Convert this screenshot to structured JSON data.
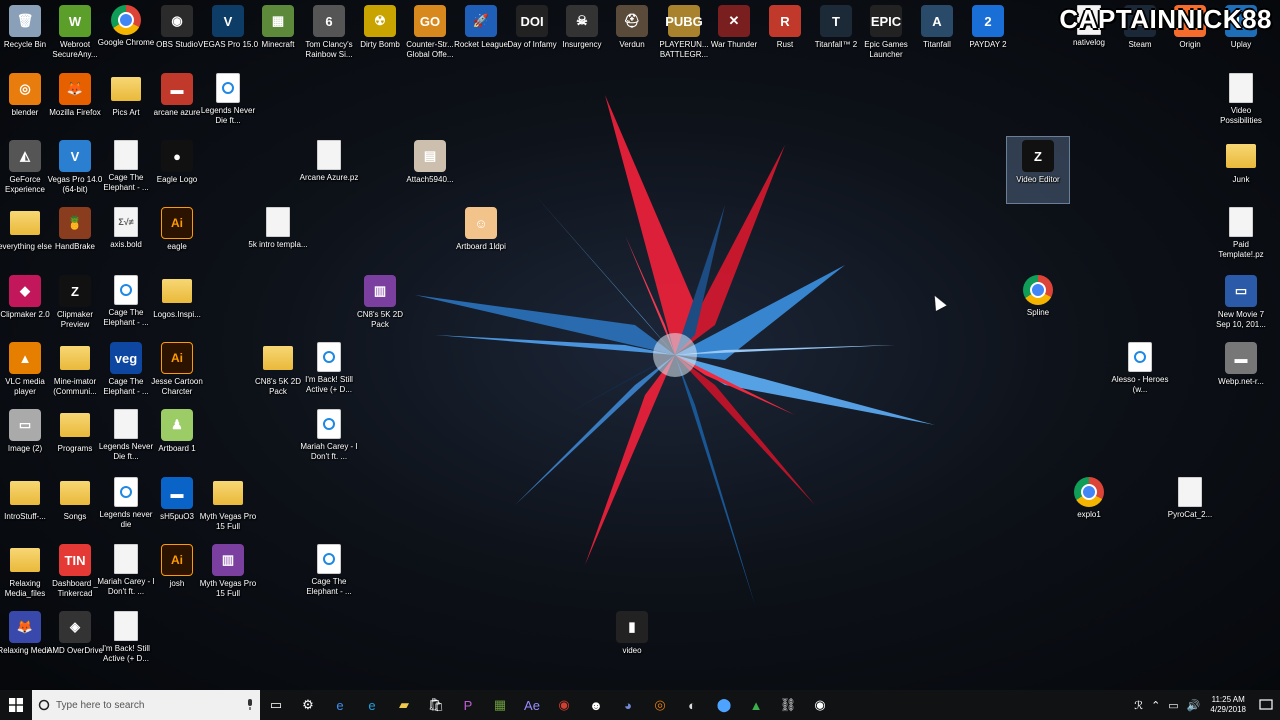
{
  "watermark": "CAPTAINNICK88",
  "desktop_icons": [
    {
      "id": "recycle-bin",
      "label": "Recycle Bin",
      "glyph": "🗑",
      "bg": "#8aa0b8",
      "type": "app",
      "selected": false
    },
    {
      "id": "webroot",
      "label": "Webroot SecureAny...",
      "glyph": "W",
      "bg": "#5c9e2a",
      "type": "app",
      "selected": false
    },
    {
      "id": "google-chrome",
      "label": "Google Chrome",
      "glyph": "",
      "bg": "",
      "type": "chrome",
      "selected": false
    },
    {
      "id": "obs-studio",
      "label": "OBS Studio",
      "glyph": "◉",
      "bg": "#2b2b2b",
      "type": "app",
      "selected": false
    },
    {
      "id": "vegas-pro-15",
      "label": "VEGAS Pro 15.0",
      "glyph": "V",
      "bg": "#0d3d66",
      "type": "app",
      "selected": false
    },
    {
      "id": "minecraft",
      "label": "Minecraft",
      "glyph": "▦",
      "bg": "#5d8a3a",
      "type": "app",
      "selected": false
    },
    {
      "id": "rainbow-six",
      "label": "Tom Clancy's Rainbow Si...",
      "glyph": "6",
      "bg": "#555",
      "type": "app",
      "selected": false
    },
    {
      "id": "dirty-bomb",
      "label": "Dirty Bomb",
      "glyph": "☢",
      "bg": "#c9a400",
      "type": "app",
      "selected": false
    },
    {
      "id": "csgo",
      "label": "Counter-Str... Global Offe...",
      "glyph": "GO",
      "bg": "#d8891d",
      "type": "app",
      "selected": false
    },
    {
      "id": "rocket-league",
      "label": "Rocket League",
      "glyph": "🚀",
      "bg": "#1f5fb8",
      "type": "app",
      "selected": false
    },
    {
      "id": "day-of-infamy",
      "label": "Day of Infamy",
      "glyph": "DOI",
      "bg": "#222",
      "type": "app",
      "selected": false
    },
    {
      "id": "insurgency",
      "label": "Insurgency",
      "glyph": "☠",
      "bg": "#333",
      "type": "app",
      "selected": false
    },
    {
      "id": "verdun",
      "label": "Verdun",
      "glyph": "⛑",
      "bg": "#5a4a3a",
      "type": "app",
      "selected": false
    },
    {
      "id": "pubg",
      "label": "PLAYERUN... BATTLEGR...",
      "glyph": "PUBG",
      "bg": "#a8822d",
      "type": "app",
      "selected": false
    },
    {
      "id": "war-thunder",
      "label": "War Thunder",
      "glyph": "✕",
      "bg": "#7a1f1f",
      "type": "app",
      "selected": false
    },
    {
      "id": "rust",
      "label": "Rust",
      "glyph": "R",
      "bg": "#c0392b",
      "type": "app",
      "selected": false
    },
    {
      "id": "titanfall-2",
      "label": "Titanfall™ 2",
      "glyph": "T",
      "bg": "#1c2a38",
      "type": "app",
      "selected": false
    },
    {
      "id": "epic-games",
      "label": "Epic Games Launcher",
      "glyph": "EPIC",
      "bg": "#222",
      "type": "app",
      "selected": false
    },
    {
      "id": "titanfall",
      "label": "Titanfall",
      "glyph": "A",
      "bg": "#2a4a6a",
      "type": "app",
      "selected": false
    },
    {
      "id": "payday-2",
      "label": "PAYDAY 2",
      "glyph": "2",
      "bg": "#1a6fd6",
      "type": "app",
      "selected": false
    },
    {
      "id": "nativelog",
      "label": "nativelog",
      "glyph": "",
      "bg": "",
      "type": "doc",
      "selected": false
    },
    {
      "id": "steam",
      "label": "Steam",
      "glyph": "S",
      "bg": "#1b2838",
      "type": "app",
      "selected": false
    },
    {
      "id": "origin",
      "label": "Origin",
      "glyph": "O",
      "bg": "#f56c2d",
      "type": "app",
      "selected": false
    },
    {
      "id": "uplay",
      "label": "Uplay",
      "glyph": "U",
      "bg": "#1e6fb8",
      "type": "app",
      "selected": false
    },
    {
      "id": "blender",
      "label": "blender",
      "glyph": "◎",
      "bg": "#e87d0d",
      "type": "app",
      "selected": false
    },
    {
      "id": "firefox",
      "label": "Mozilla Firefox",
      "glyph": "🦊",
      "bg": "#e66000",
      "type": "app",
      "selected": false
    },
    {
      "id": "pics-art",
      "label": "Pics Art",
      "glyph": "",
      "bg": "",
      "type": "folder",
      "selected": false
    },
    {
      "id": "arcane-azure",
      "label": "arcane azure",
      "glyph": "▬",
      "bg": "#c0392b",
      "type": "app",
      "selected": false
    },
    {
      "id": "legends-never-die-1",
      "label": "Legends Never Die ft...",
      "glyph": "",
      "bg": "",
      "type": "wmp",
      "selected": false
    },
    {
      "id": "video-possibilities",
      "label": "Video Possibilities",
      "glyph": "",
      "bg": "",
      "type": "doc",
      "selected": false
    },
    {
      "id": "geforce-experience",
      "label": "GeForce Experience",
      "glyph": "◭",
      "bg": "#555",
      "type": "app",
      "selected": false
    },
    {
      "id": "vegas-pro-14",
      "label": "Vegas Pro 14.0 (64-bit)",
      "glyph": "V",
      "bg": "#2a7fd1",
      "type": "app",
      "selected": false
    },
    {
      "id": "cage-elephant-1",
      "label": "Cage The Elephant - ...",
      "glyph": "",
      "bg": "",
      "type": "doc",
      "selected": false
    },
    {
      "id": "eagle-logo",
      "label": "Eagle Logo",
      "glyph": "●",
      "bg": "#111",
      "type": "app",
      "selected": false
    },
    {
      "id": "arcane-azure-pz",
      "label": "Arcane Azure.pz",
      "glyph": "",
      "bg": "",
      "type": "doc",
      "selected": false
    },
    {
      "id": "attach5940",
      "label": "Attach5940...",
      "glyph": "▤",
      "bg": "#cdbfae",
      "type": "app",
      "selected": false
    },
    {
      "id": "video-editor",
      "label": "Video Editor",
      "glyph": "Z",
      "bg": "#111",
      "type": "app",
      "selected": true
    },
    {
      "id": "junk",
      "label": "Junk",
      "glyph": "",
      "bg": "",
      "type": "folder",
      "selected": false
    },
    {
      "id": "everything-else",
      "label": "everything else",
      "glyph": "",
      "bg": "",
      "type": "folder",
      "selected": false
    },
    {
      "id": "handbrake",
      "label": "HandBrake",
      "glyph": "🍍",
      "bg": "#8a3c1e",
      "type": "app",
      "selected": false
    },
    {
      "id": "axis-bold",
      "label": "axis.bold",
      "glyph": "Σ√≠",
      "bg": "",
      "type": "doc",
      "selected": false
    },
    {
      "id": "eagle",
      "label": "eagle",
      "glyph": "Ai",
      "bg": "",
      "type": "ai",
      "selected": false
    },
    {
      "id": "5k-intro",
      "label": "5k intro templa...",
      "glyph": "",
      "bg": "",
      "type": "doc",
      "selected": false
    },
    {
      "id": "artboard-1ldpi",
      "label": "Artboard 1ldpi",
      "glyph": "☺",
      "bg": "#f2c38b",
      "type": "app",
      "selected": false
    },
    {
      "id": "paid-template",
      "label": "Paid Template!.pz",
      "glyph": "",
      "bg": "",
      "type": "doc",
      "selected": false
    },
    {
      "id": "clipmaker-2",
      "label": "Clipmaker 2.0",
      "glyph": "◆",
      "bg": "#c2185b",
      "type": "app",
      "selected": false
    },
    {
      "id": "clipmaker-preview",
      "label": "Clipmaker Preview",
      "glyph": "Z",
      "bg": "#111",
      "type": "app",
      "selected": false
    },
    {
      "id": "cage-elephant-2",
      "label": "Cage The Elephant - ...",
      "glyph": "",
      "bg": "",
      "type": "wmp",
      "selected": false
    },
    {
      "id": "logos-inspi",
      "label": "Logos.Inspi...",
      "glyph": "",
      "bg": "",
      "type": "folder",
      "selected": false
    },
    {
      "id": "cn8-5k-2d-pack-rar",
      "label": "CN8's 5K 2D Pack",
      "glyph": "▥",
      "bg": "#7b3fa0",
      "type": "app",
      "selected": false
    },
    {
      "id": "spline",
      "label": "Spline",
      "glyph": "",
      "bg": "",
      "type": "chrome",
      "selected": false
    },
    {
      "id": "new-movie-7",
      "label": "New Movie 7 Sep 10, 201...",
      "glyph": "▭",
      "bg": "#2a5aa8",
      "type": "app",
      "selected": false
    },
    {
      "id": "vlc",
      "label": "VLC media player",
      "glyph": "▲",
      "bg": "#e67e00",
      "type": "app",
      "selected": false
    },
    {
      "id": "mine-imator",
      "label": "Mine-imator (Communi...",
      "glyph": "",
      "bg": "",
      "type": "folder",
      "selected": false
    },
    {
      "id": "cage-elephant-3",
      "label": "Cage The Elephant - ...",
      "glyph": "veg",
      "bg": "#0d47a1",
      "type": "app",
      "selected": false
    },
    {
      "id": "jesse-cartoon",
      "label": "Jesse Cartoon Charcter",
      "glyph": "Ai",
      "bg": "",
      "type": "ai",
      "selected": false
    },
    {
      "id": "cn8-5k-2d-pack",
      "label": "CN8's 5K 2D Pack",
      "glyph": "",
      "bg": "",
      "type": "folder",
      "selected": false
    },
    {
      "id": "im-back-1",
      "label": "I'm Back! Still Active (+ D...",
      "glyph": "",
      "bg": "",
      "type": "wmp",
      "selected": false
    },
    {
      "id": "alesso-heroes",
      "label": "Alesso - Heroes (w...",
      "glyph": "",
      "bg": "",
      "type": "wmp",
      "selected": false
    },
    {
      "id": "webp-net",
      "label": "Webp.net-r...",
      "glyph": "▬",
      "bg": "#777",
      "type": "app",
      "selected": false
    },
    {
      "id": "image-2",
      "label": "Image (2)",
      "glyph": "▭",
      "bg": "#aaa",
      "type": "app",
      "selected": false
    },
    {
      "id": "programs",
      "label": "Programs",
      "glyph": "",
      "bg": "",
      "type": "folder",
      "selected": false
    },
    {
      "id": "legends-never-die-2",
      "label": "Legends Never Die ft...",
      "glyph": "",
      "bg": "",
      "type": "doc",
      "selected": false
    },
    {
      "id": "artboard-1",
      "label": "Artboard 1",
      "glyph": "♟",
      "bg": "#9ccc65",
      "type": "app",
      "selected": false
    },
    {
      "id": "mariah-carey-1",
      "label": "Mariah Carey - I Don't ft. ...",
      "glyph": "",
      "bg": "",
      "type": "wmp",
      "selected": false
    },
    {
      "id": "introstuff",
      "label": "IntroStuff-...",
      "glyph": "",
      "bg": "",
      "type": "folder",
      "selected": false
    },
    {
      "id": "songs",
      "label": "Songs",
      "glyph": "",
      "bg": "",
      "type": "folder",
      "selected": false
    },
    {
      "id": "legends-never-die-3",
      "label": "Legends never die",
      "glyph": "",
      "bg": "",
      "type": "wmp",
      "selected": false
    },
    {
      "id": "sh5pu03",
      "label": "sH5puO3",
      "glyph": "▬",
      "bg": "#0a64c8",
      "type": "app",
      "selected": false
    },
    {
      "id": "myth-vegas-1",
      "label": "Myth Vegas Pro 15 Full",
      "glyph": "",
      "bg": "",
      "type": "folder",
      "selected": false
    },
    {
      "id": "explo1",
      "label": "explo1",
      "glyph": "",
      "bg": "",
      "type": "chrome",
      "selected": false
    },
    {
      "id": "pyrocat-2",
      "label": "PyroCat_2...",
      "glyph": "",
      "bg": "",
      "type": "doc",
      "selected": false
    },
    {
      "id": "relaxing-media-files",
      "label": "Relaxing Media_files",
      "glyph": "",
      "bg": "",
      "type": "folder",
      "selected": false
    },
    {
      "id": "dashboard-tinkercad",
      "label": "Dashboard _ Tinkercad",
      "glyph": "TIN",
      "bg": "#e53935",
      "type": "app",
      "selected": false
    },
    {
      "id": "mariah-carey-2",
      "label": "Mariah Carey - I Don't ft. ...",
      "glyph": "",
      "bg": "",
      "type": "doc",
      "selected": false
    },
    {
      "id": "josh",
      "label": "josh",
      "glyph": "Ai",
      "bg": "",
      "type": "ai",
      "selected": false
    },
    {
      "id": "myth-vegas-2",
      "label": "Myth Vegas Pro 15 Full",
      "glyph": "▥",
      "bg": "#7b3fa0",
      "type": "app",
      "selected": false
    },
    {
      "id": "cage-elephant-4",
      "label": "Cage The Elephant - ...",
      "glyph": "",
      "bg": "",
      "type": "wmp",
      "selected": false
    },
    {
      "id": "relaxing-media",
      "label": "Relaxing Media",
      "glyph": "🦊",
      "bg": "#3949ab",
      "type": "app",
      "selected": false
    },
    {
      "id": "amd-overdrive",
      "label": "AMD OverDrive",
      "glyph": "◈",
      "bg": "#333",
      "type": "app",
      "selected": false
    },
    {
      "id": "im-back-2",
      "label": "I'm Back! Still Active (+ D...",
      "glyph": "",
      "bg": "",
      "type": "doc",
      "selected": false
    },
    {
      "id": "video",
      "label": "video",
      "glyph": "▮",
      "bg": "#222",
      "type": "app",
      "selected": false
    }
  ],
  "taskbar": {
    "search_placeholder": "Type here to search",
    "pinned": [
      {
        "name": "task-view",
        "glyph": "▭",
        "color": "#fff"
      },
      {
        "name": "settings",
        "glyph": "⚙",
        "color": "#fff"
      },
      {
        "name": "edge",
        "glyph": "e",
        "color": "#3d8ef0"
      },
      {
        "name": "internet-explorer",
        "glyph": "e",
        "color": "#1ea0e0"
      },
      {
        "name": "file-explorer",
        "glyph": "▰",
        "color": "#f2c94c"
      },
      {
        "name": "store",
        "glyph": "🛍",
        "color": "#fff"
      },
      {
        "name": "picsart",
        "glyph": "P",
        "color": "#c05dd6"
      },
      {
        "name": "minecraft",
        "glyph": "▦",
        "color": "#6a9a3a"
      },
      {
        "name": "after-effects",
        "glyph": "Ae",
        "color": "#9a8cff"
      },
      {
        "name": "app-red",
        "glyph": "◉",
        "color": "#d04030"
      },
      {
        "name": "app-panda",
        "glyph": "☻",
        "color": "#fff"
      },
      {
        "name": "discord",
        "glyph": "◕",
        "color": "#7289da"
      },
      {
        "name": "blender",
        "glyph": "◎",
        "color": "#e87d0d"
      },
      {
        "name": "app-lens",
        "glyph": "◐",
        "color": "#ddd"
      },
      {
        "name": "maps",
        "glyph": "⬤",
        "color": "#4da3ff"
      },
      {
        "name": "app-green",
        "glyph": "▲",
        "color": "#3cb04a"
      },
      {
        "name": "app-network",
        "glyph": "⛓",
        "color": "#ddd"
      },
      {
        "name": "obs",
        "glyph": "◉",
        "color": "#fff"
      }
    ],
    "tray": [
      "ℛ",
      "⌃",
      "▭",
      "🔊"
    ],
    "time": "11:25 AM",
    "date": "4/29/2018"
  }
}
